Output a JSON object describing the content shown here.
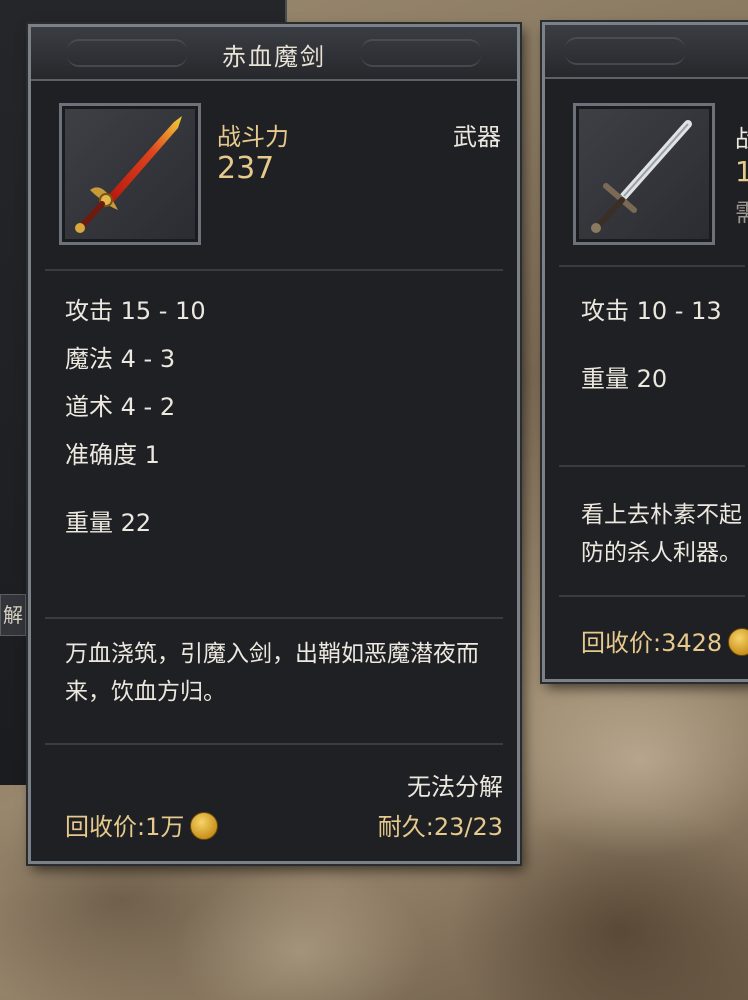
{
  "main_tooltip": {
    "title": "赤血魔剑",
    "power_label": "战斗力",
    "power_value": "237",
    "item_type": "武器",
    "stats": [
      "攻击 15 - 10",
      "魔法 4 - 3",
      "道术 4 - 2",
      "准确度 1"
    ],
    "weight": "重量 22",
    "description": "万血浇筑，引魔入剑，出鞘如恶魔潜夜而来，饮血方归。",
    "dismantle": "无法分解",
    "recycle_price": "回收价:1万",
    "durability": "耐久:23/23"
  },
  "side_tooltip": {
    "power_label_partial": "战",
    "power_value_partial": "1",
    "req_partial": "需",
    "attack": "攻击 10 - 13",
    "weight": "重量 20",
    "description_line1": "看上去朴素不起",
    "description_line2": "防的杀人利器。",
    "recycle_price": "回收价:3428"
  },
  "background_window": {
    "tab_label_partial": "解"
  },
  "colors": {
    "gold_text": "#e6c98c",
    "white_text": "#ece8df",
    "panel_bg": "#1f2023",
    "panel_border": "#7c8087"
  },
  "icons": {
    "main_item": "red-sword-icon",
    "side_item": "steel-sword-icon",
    "currency": "gold-coin-icon"
  }
}
